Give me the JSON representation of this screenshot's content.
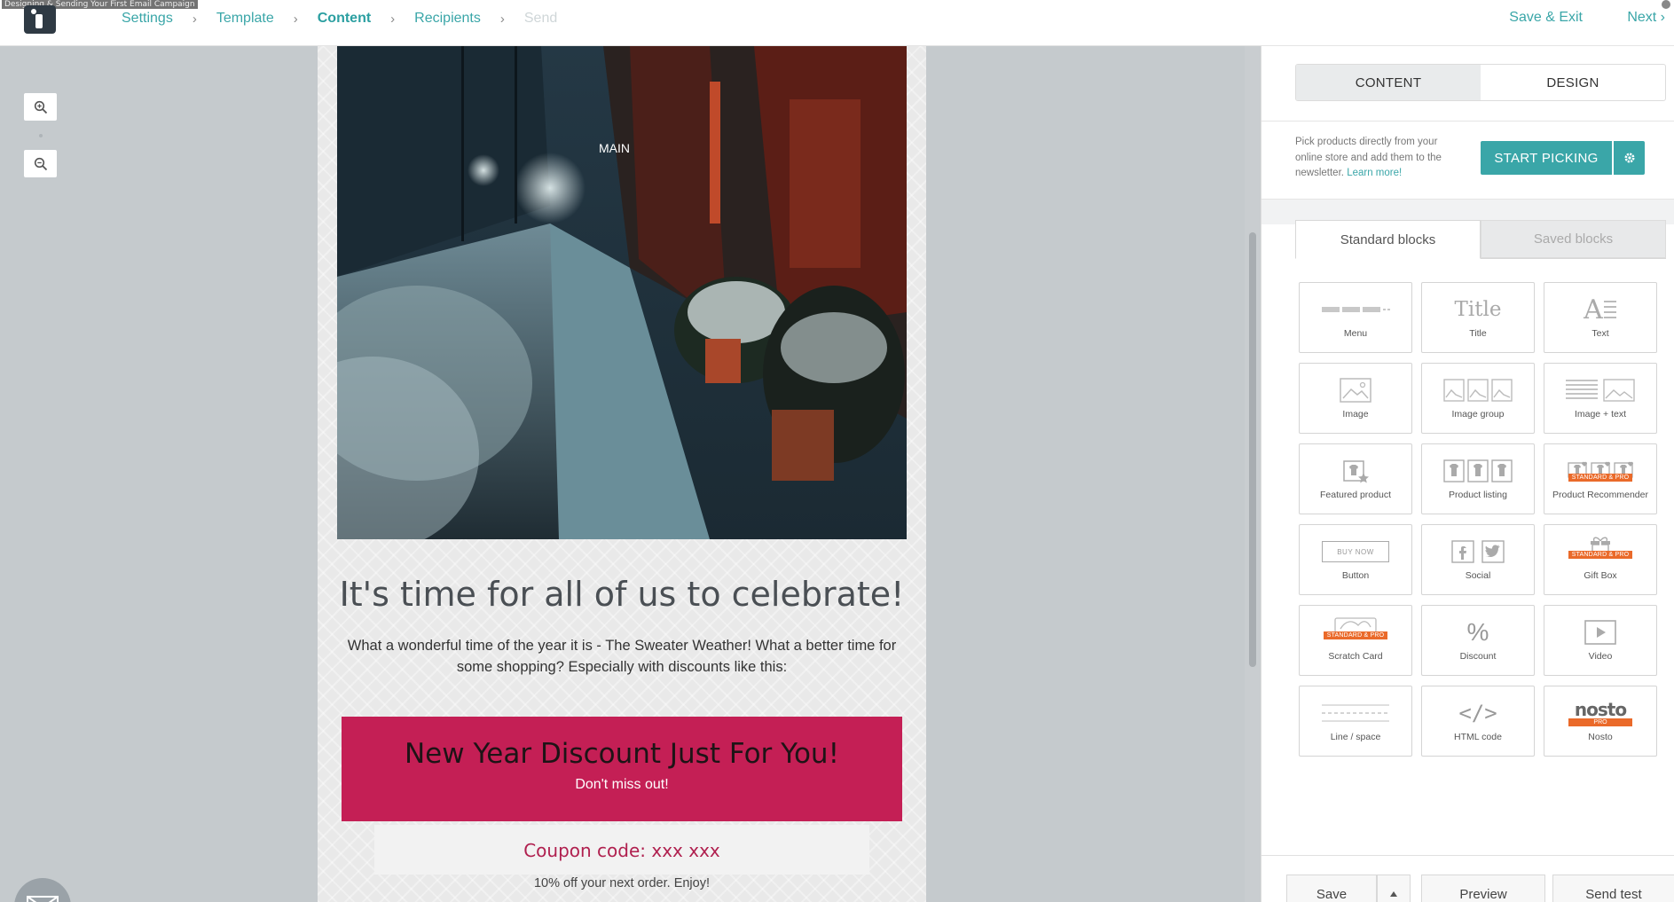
{
  "video_title": "Designing & Sending Your First Email Campaign",
  "breadcrumbs": [
    {
      "label": "Settings",
      "state": "done"
    },
    {
      "label": "Template",
      "state": "done"
    },
    {
      "label": "Content",
      "state": "active"
    },
    {
      "label": "Recipients",
      "state": "done"
    },
    {
      "label": "Send",
      "state": "disabled"
    }
  ],
  "topbar": {
    "save_exit": "Save & Exit",
    "next": "Next"
  },
  "email": {
    "headline": "It's time for all of us to celebrate!",
    "intro": "What a wonderful time of the year it is - The Sweater Weather! What a better time for some shopping? Especially with discounts like this:",
    "discount_title": "New Year Discount Just For You!",
    "discount_sub": "Don't miss out!",
    "coupon": "Coupon code: xxx xxx",
    "coupon_note": "10% off your next order. Enjoy!",
    "hero_sign": "MAIN",
    "accent": "#c41f55"
  },
  "panel": {
    "tabs": [
      "CONTENT",
      "DESIGN"
    ],
    "active_tab": "CONTENT",
    "picker_text": "Pick products directly from your online store and add them to the newsletter.",
    "learn_more": "Learn more!",
    "start_picking": "START PICKING",
    "block_tabs": [
      "Standard blocks",
      "Saved blocks"
    ],
    "blocks": [
      {
        "label": "Menu",
        "icon": "menu-icon"
      },
      {
        "label": "Title",
        "icon": "title-icon",
        "glyph": "Title"
      },
      {
        "label": "Text",
        "icon": "text-icon",
        "glyph": "A"
      },
      {
        "label": "Image",
        "icon": "image-icon"
      },
      {
        "label": "Image group",
        "icon": "image-group-icon"
      },
      {
        "label": "Image + text",
        "icon": "image-text-icon"
      },
      {
        "label": "Featured product",
        "icon": "featured-product-icon"
      },
      {
        "label": "Product listing",
        "icon": "product-listing-icon"
      },
      {
        "label": "Product Recommender",
        "icon": "product-recommender-icon",
        "badge": "STANDARD & PRO"
      },
      {
        "label": "Button",
        "icon": "button-icon",
        "glyph": "BUY NOW"
      },
      {
        "label": "Social",
        "icon": "social-icon"
      },
      {
        "label": "Gift Box",
        "icon": "gift-box-icon",
        "badge": "STANDARD & PRO"
      },
      {
        "label": "Scratch Card",
        "icon": "scratch-card-icon",
        "badge": "STANDARD & PRO"
      },
      {
        "label": "Discount",
        "icon": "discount-icon",
        "glyph": "%"
      },
      {
        "label": "Video",
        "icon": "video-icon"
      },
      {
        "label": "Line / space",
        "icon": "line-space-icon"
      },
      {
        "label": "HTML code",
        "icon": "html-code-icon",
        "glyph": "</>"
      },
      {
        "label": "Nosto",
        "icon": "nosto-icon",
        "glyph": "nosto",
        "badge": "PRO"
      }
    ],
    "footer": {
      "save": "Save",
      "preview": "Preview",
      "send_test": "Send test"
    },
    "accent": "#3aa6a8"
  }
}
